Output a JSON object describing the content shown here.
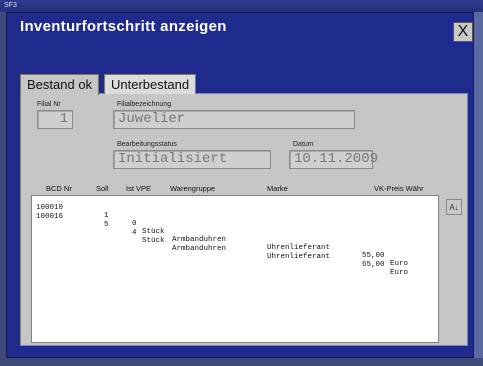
{
  "titlebar": {
    "text": "SF3"
  },
  "window": {
    "title": "Inventurfortschritt anzeigen",
    "close_glyph": "X"
  },
  "tabs": [
    {
      "label": "Bestand ok"
    },
    {
      "label": "Unterbestand"
    }
  ],
  "fields": {
    "filial_nr": {
      "label": "Filial Nr",
      "value": "1"
    },
    "filialbezeichnung": {
      "label": "Filialbezeichnung",
      "value": "Juwelier"
    },
    "bearbeitungsstatus": {
      "label": "Bearbeitungsstatus",
      "value": "Initialisiert"
    },
    "datum": {
      "label": "Datum",
      "value": "10.11.2009"
    }
  },
  "table": {
    "columns": [
      "BCD Nr",
      "Soll",
      "Ist VPE",
      "Warengruppe",
      "Marke",
      "VK-Preis Währ"
    ],
    "rows": [
      {
        "bcd": "100010",
        "soll": "1",
        "ist": "0",
        "vpe": "Stück",
        "warengruppe": "Armbanduhren",
        "marke": "Uhrenlieferant",
        "preis": "55,00",
        "waehr": "Euro"
      },
      {
        "bcd": "100016",
        "soll": "5",
        "ist": "4",
        "vpe": "Stück",
        "warengruppe": "Armbanduhren",
        "marke": "Uhrenlieferant",
        "preis": "65,00",
        "waehr": "Euro"
      }
    ]
  },
  "sort_button": {
    "icon": "sort-az-icon",
    "glyph": "A↓"
  }
}
